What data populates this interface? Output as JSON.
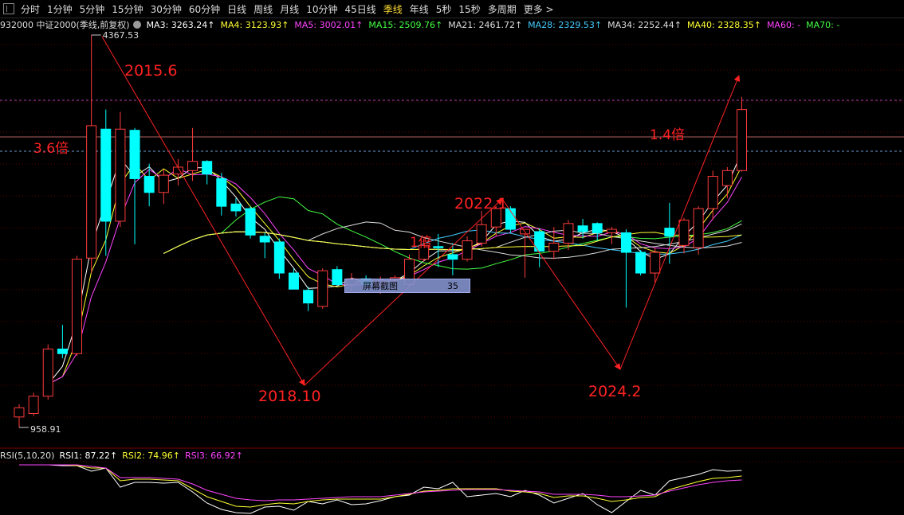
{
  "toolbar": {
    "items": [
      "分时",
      "1分钟",
      "5分钟",
      "15分钟",
      "30分钟",
      "60分钟",
      "日线",
      "周线",
      "月线",
      "10分钟",
      "45日线",
      "季线",
      "年线",
      "5秒",
      "15秒",
      "多周期",
      "更多 >"
    ],
    "active": "季线"
  },
  "legend": {
    "code_name": "932000 中证2000(季线,前复权)",
    "ma": [
      {
        "label": "MA3: 3263.24↑",
        "color": "#ffffff"
      },
      {
        "label": "MA4: 3123.93↑",
        "color": "#ffff33"
      },
      {
        "label": "MA5: 3002.01↑",
        "color": "#ff44ff"
      },
      {
        "label": "MA15: 2509.76↑",
        "color": "#44ff44"
      },
      {
        "label": "MA21: 2461.72↑",
        "color": "#dddddd"
      },
      {
        "label": "MA28: 2329.53↑",
        "color": "#44ccff"
      },
      {
        "label": "MA34: 2252.44↑",
        "color": "#dddddd"
      },
      {
        "label": "MA40: 2328.35↑",
        "color": "#ffff33"
      },
      {
        "label": "MA60: -",
        "color": "#ff44ff"
      },
      {
        "label": "MA70: -",
        "color": "#44ff44"
      }
    ]
  },
  "price_labels": {
    "high": "4367.53",
    "low": "958.91"
  },
  "annotations": {
    "a2015": "2015.6",
    "a36": "3.6倍",
    "a2022": "2022.1",
    "a1x": "1倍",
    "a14": "1.4倍",
    "a2018": "2018.10",
    "a2024": "2024.2"
  },
  "screenshot_tag": {
    "label": "屏幕截图",
    "value": "35"
  },
  "rsi_legend": [
    {
      "label": "RSI(5,10,20)",
      "color": "#dddddd"
    },
    {
      "label": "RSI1: 87.22↑",
      "color": "#ffffff"
    },
    {
      "label": "RSI2: 74.96↑",
      "color": "#ffff33"
    },
    {
      "label": "RSI3: 66.92↑",
      "color": "#ff44ff"
    }
  ],
  "colors": {
    "up": "#ff3b3b",
    "down": "#00ffff",
    "annotation": "#ff2222"
  },
  "chart_data": {
    "type": "candlestick",
    "candles": [
      {
        "o": 1050,
        "h": 1160,
        "l": 958.91,
        "c": 1130
      },
      {
        "o": 1080,
        "h": 1260,
        "l": 1060,
        "c": 1230
      },
      {
        "o": 1230,
        "h": 1680,
        "l": 1200,
        "c": 1640
      },
      {
        "o": 1640,
        "h": 1850,
        "l": 1560,
        "c": 1600
      },
      {
        "o": 1600,
        "h": 2450,
        "l": 1580,
        "c": 2420
      },
      {
        "o": 2430,
        "h": 4367.53,
        "l": 2300,
        "c": 3580
      },
      {
        "o": 3550,
        "h": 3720,
        "l": 2450,
        "c": 2750
      },
      {
        "o": 2750,
        "h": 3700,
        "l": 2700,
        "c": 3550
      },
      {
        "o": 3540,
        "h": 3560,
        "l": 2550,
        "c": 3120
      },
      {
        "o": 3140,
        "h": 3250,
        "l": 2880,
        "c": 3000
      },
      {
        "o": 3000,
        "h": 3200,
        "l": 2900,
        "c": 3150
      },
      {
        "o": 3160,
        "h": 3290,
        "l": 3060,
        "c": 3220
      },
      {
        "o": 3190,
        "h": 3560,
        "l": 3100,
        "c": 3270
      },
      {
        "o": 3270,
        "h": 3280,
        "l": 3070,
        "c": 3160
      },
      {
        "o": 3120,
        "h": 3170,
        "l": 2800,
        "c": 2880
      },
      {
        "o": 2900,
        "h": 2950,
        "l": 2790,
        "c": 2840
      },
      {
        "o": 2860,
        "h": 2880,
        "l": 2600,
        "c": 2630
      },
      {
        "o": 2620,
        "h": 2650,
        "l": 2430,
        "c": 2570
      },
      {
        "o": 2570,
        "h": 2600,
        "l": 2250,
        "c": 2300
      },
      {
        "o": 2300,
        "h": 2340,
        "l": 2160,
        "c": 2160
      },
      {
        "o": 2150,
        "h": 2180,
        "l": 1970,
        "c": 2040
      },
      {
        "o": 2010,
        "h": 2340,
        "l": 1990,
        "c": 2320
      },
      {
        "o": 2330,
        "h": 2360,
        "l": 2190,
        "c": 2200
      },
      {
        "o": 2200,
        "h": 2300,
        "l": 2140,
        "c": 2250
      },
      {
        "o": 2250,
        "h": 2280,
        "l": 2150,
        "c": 2200
      },
      {
        "o": 2200,
        "h": 2270,
        "l": 2120,
        "c": 2230
      },
      {
        "o": 2240,
        "h": 2280,
        "l": 2160,
        "c": 2260
      },
      {
        "o": 2200,
        "h": 2460,
        "l": 2180,
        "c": 2420
      },
      {
        "o": 2420,
        "h": 2600,
        "l": 2400,
        "c": 2540
      },
      {
        "o": 2530,
        "h": 2640,
        "l": 2350,
        "c": 2520
      },
      {
        "o": 2460,
        "h": 2560,
        "l": 2280,
        "c": 2420
      },
      {
        "o": 2420,
        "h": 2620,
        "l": 2400,
        "c": 2580
      },
      {
        "o": 2560,
        "h": 2840,
        "l": 2530,
        "c": 2720
      },
      {
        "o": 2700,
        "h": 2880,
        "l": 2620,
        "c": 2860
      },
      {
        "o": 2860,
        "h": 2880,
        "l": 2650,
        "c": 2680
      },
      {
        "o": 2640,
        "h": 2680,
        "l": 2260,
        "c": 2680
      },
      {
        "o": 2660,
        "h": 2690,
        "l": 2350,
        "c": 2490
      },
      {
        "o": 2490,
        "h": 2700,
        "l": 2420,
        "c": 2560
      },
      {
        "o": 2560,
        "h": 2760,
        "l": 2500,
        "c": 2730
      },
      {
        "o": 2710,
        "h": 2770,
        "l": 2600,
        "c": 2660
      },
      {
        "o": 2730,
        "h": 2740,
        "l": 2580,
        "c": 2650
      },
      {
        "o": 2650,
        "h": 2700,
        "l": 2550,
        "c": 2680
      },
      {
        "o": 2650,
        "h": 2680,
        "l": 2000,
        "c": 2480
      },
      {
        "o": 2480,
        "h": 2500,
        "l": 2280,
        "c": 2300
      },
      {
        "o": 2300,
        "h": 2520,
        "l": 2220,
        "c": 2480
      },
      {
        "o": 2690,
        "h": 2910,
        "l": 2380,
        "c": 2620
      },
      {
        "o": 2540,
        "h": 2780,
        "l": 2470,
        "c": 2760
      },
      {
        "o": 2520,
        "h": 2880,
        "l": 2460,
        "c": 2860
      },
      {
        "o": 2860,
        "h": 3190,
        "l": 2760,
        "c": 3140
      },
      {
        "o": 3060,
        "h": 3220,
        "l": 2950,
        "c": 3190
      },
      {
        "o": 3190,
        "h": 3830,
        "l": 3180,
        "c": 3720
      }
    ]
  }
}
